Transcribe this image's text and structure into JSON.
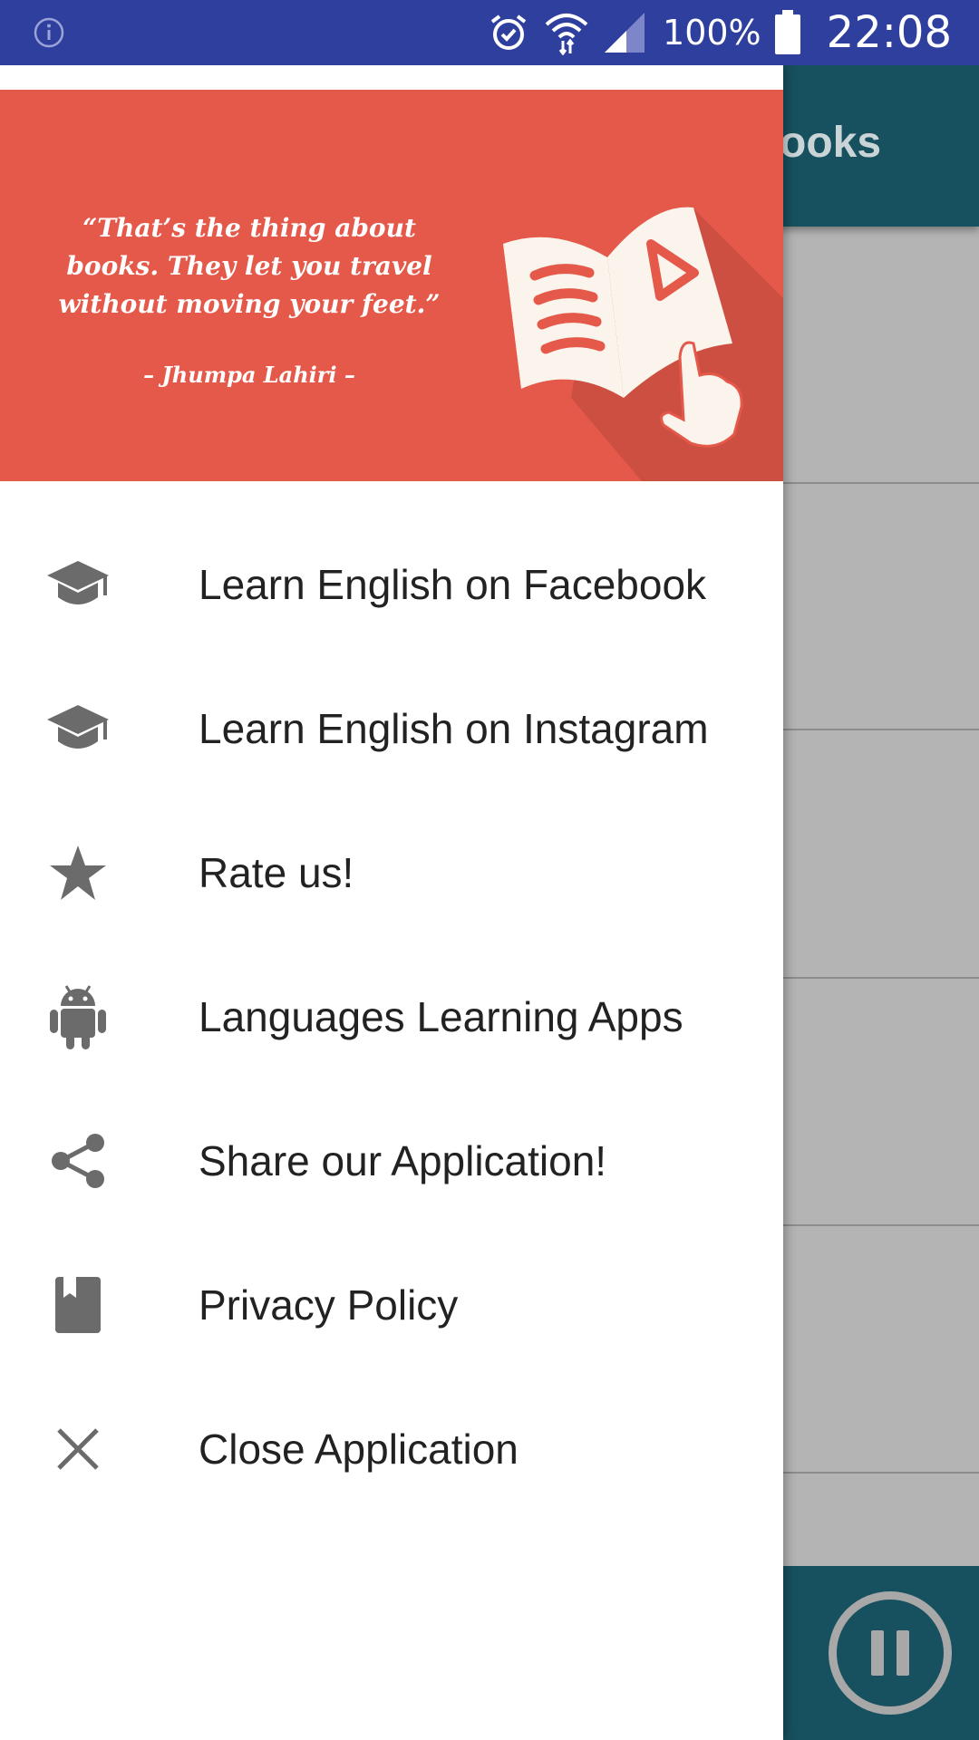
{
  "status_bar": {
    "battery_percent": "100%",
    "time": "22:08",
    "icons": [
      "info-icon",
      "alarm-icon",
      "wifi-icon",
      "signal-icon",
      "battery-icon"
    ]
  },
  "app": {
    "toolbar_title_visible": "ooks",
    "player_state": "pause-icon"
  },
  "drawer": {
    "header": {
      "quote": "“That’s the thing about books. They let you travel without moving your feet.”",
      "author": "– Jhumpa Lahiri –",
      "background_color": "#e5594a"
    },
    "menu": [
      {
        "label": "Learn English on Facebook",
        "icon": "graduation-cap-icon"
      },
      {
        "label": "Learn English on Instagram",
        "icon": "graduation-cap-icon"
      },
      {
        "label": "Rate us!",
        "icon": "star-icon"
      },
      {
        "label": "Languages Learning Apps",
        "icon": "android-icon"
      },
      {
        "label": "Share our Application!",
        "icon": "share-icon"
      },
      {
        "label": "Privacy Policy",
        "icon": "book-icon"
      },
      {
        "label": "Close Application",
        "icon": "close-icon"
      }
    ]
  },
  "colors": {
    "status_bar": "#2f3f9e",
    "toolbar": "#17505e",
    "icon_gray": "#6b6b6b"
  }
}
